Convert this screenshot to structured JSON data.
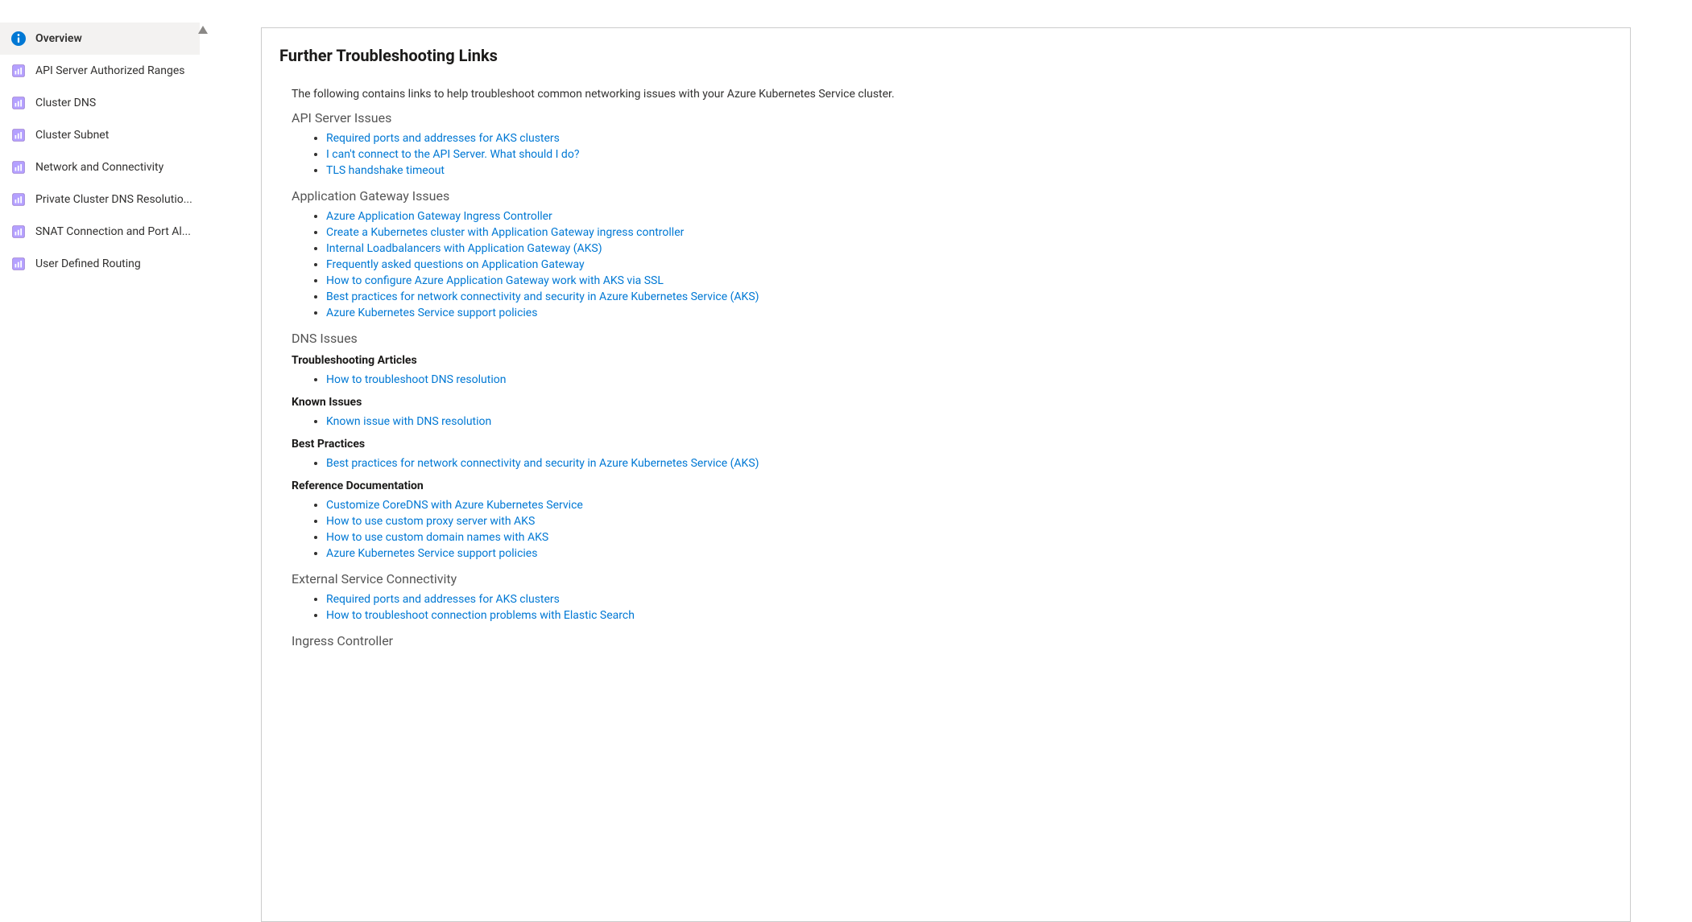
{
  "sidebar": {
    "items": [
      {
        "label": "Overview",
        "icon": "info",
        "selected": true
      },
      {
        "label": "API Server Authorized Ranges",
        "icon": "resource",
        "selected": false
      },
      {
        "label": "Cluster DNS",
        "icon": "resource",
        "selected": false
      },
      {
        "label": "Cluster Subnet",
        "icon": "resource",
        "selected": false
      },
      {
        "label": "Network and Connectivity",
        "icon": "resource",
        "selected": false
      },
      {
        "label": "Private Cluster DNS Resolutio...",
        "icon": "resource",
        "selected": false
      },
      {
        "label": "SNAT Connection and Port Al...",
        "icon": "resource",
        "selected": false
      },
      {
        "label": "User Defined Routing",
        "icon": "resource",
        "selected": false
      }
    ]
  },
  "main": {
    "title": "Further Troubleshooting Links",
    "intro": "The following contains links to help troubleshoot common networking issues with your Azure Kubernetes Service cluster.",
    "sections": [
      {
        "heading": "API Server Issues",
        "groups": [
          {
            "subheading": null,
            "links": [
              "Required ports and addresses for AKS clusters",
              "I can't connect to the API Server. What should I do?",
              "TLS handshake timeout"
            ]
          }
        ]
      },
      {
        "heading": "Application Gateway Issues",
        "groups": [
          {
            "subheading": null,
            "links": [
              "Azure Application Gateway Ingress Controller",
              "Create a Kubernetes cluster with Application Gateway ingress controller",
              "Internal Loadbalancers with Application Gateway (AKS)",
              "Frequently asked questions on Application Gateway",
              "How to configure Azure Application Gateway work with AKS via SSL",
              "Best practices for network connectivity and security in Azure Kubernetes Service (AKS)",
              "Azure Kubernetes Service support policies"
            ]
          }
        ]
      },
      {
        "heading": "DNS Issues",
        "groups": [
          {
            "subheading": "Troubleshooting Articles",
            "links": [
              "How to troubleshoot DNS resolution"
            ]
          },
          {
            "subheading": "Known Issues",
            "links": [
              "Known issue with DNS resolution"
            ]
          },
          {
            "subheading": "Best Practices",
            "links": [
              "Best practices for network connectivity and security in Azure Kubernetes Service (AKS)"
            ]
          },
          {
            "subheading": "Reference Documentation",
            "links": [
              "Customize CoreDNS with Azure Kubernetes Service",
              "How to use custom proxy server with AKS",
              "How to use custom domain names with AKS",
              "Azure Kubernetes Service support policies"
            ]
          }
        ]
      },
      {
        "heading": "External Service Connectivity",
        "groups": [
          {
            "subheading": null,
            "links": [
              "Required ports and addresses for AKS clusters",
              "How to troubleshoot connection problems with Elastic Search"
            ]
          }
        ]
      },
      {
        "heading": "Ingress Controller",
        "groups": []
      }
    ]
  }
}
